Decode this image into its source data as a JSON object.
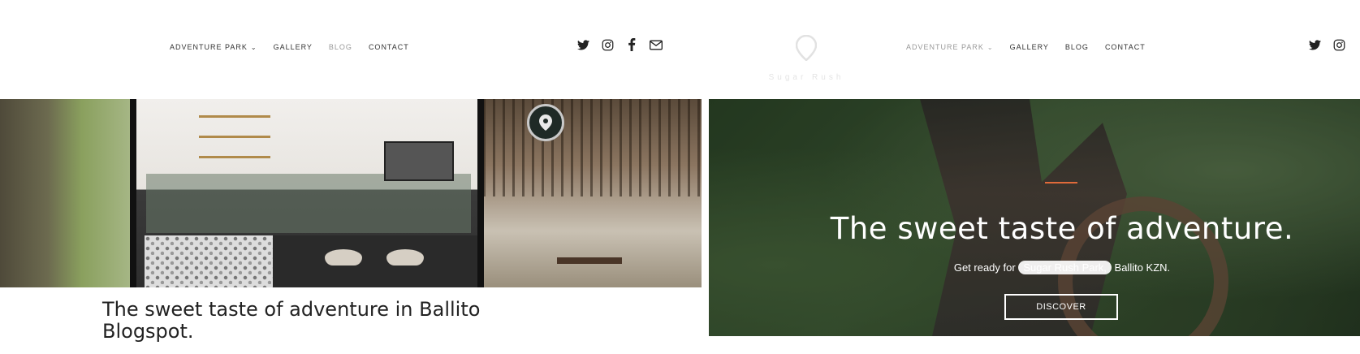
{
  "left_page": {
    "nav": {
      "links": [
        {
          "label": "ADVENTURE PARK",
          "has_dropdown": true
        },
        {
          "label": "GALLERY"
        },
        {
          "label": "BLOG",
          "muted": true
        },
        {
          "label": "CONTACT"
        }
      ],
      "social_icons": [
        "twitter-icon",
        "instagram-icon",
        "facebook-icon",
        "mail-icon"
      ]
    },
    "post_title": "The sweet taste of adventure in Ballito Blogspot."
  },
  "right_page": {
    "logo_text": "Sugar Rush",
    "nav": {
      "links": [
        {
          "label": "ADVENTURE PARK",
          "has_dropdown": true,
          "muted": true
        },
        {
          "label": "GALLERY"
        },
        {
          "label": "BLOG"
        },
        {
          "label": "CONTACT"
        }
      ],
      "social_icons": [
        "twitter-icon",
        "instagram-icon"
      ]
    },
    "hero": {
      "title": "The sweet taste of adventure.",
      "subtitle_prefix": "Get ready for ",
      "subtitle_highlight": "Sugar Rush Park,",
      "subtitle_suffix": " Ballito KZN.",
      "button_label": "DISCOVER"
    }
  },
  "colors": {
    "accent": "#e06a3a",
    "text_dark": "#222222",
    "nav_muted": "#999999"
  }
}
